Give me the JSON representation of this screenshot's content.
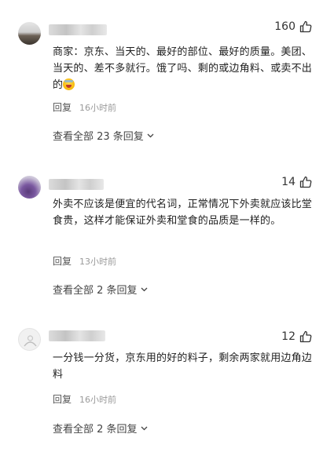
{
  "comments": [
    {
      "likes": "160",
      "text": "商家：京东、当天的、最好的部位、最好的质量。美团、当天的、差不多就行。饿了吗、剩的或边角料、或卖不出的",
      "reply_label": "回复",
      "time": "16小时前",
      "view_all": "查看全部 23 条回复"
    },
    {
      "likes": "14",
      "text": "外卖不应该是便宜的代名词，正常情况下外卖就应该比堂食贵，这样才能保证外卖和堂食的品质是一样的。",
      "reply_label": "回复",
      "time": "13小时前",
      "view_all": "查看全部 2 条回复"
    },
    {
      "likes": "12",
      "text": "一分钱一分货，京东用的好的料子，剩余两家就用边角边料",
      "reply_label": "回复",
      "time": "16小时前",
      "view_all": "查看全部 2 条回复"
    }
  ],
  "icons": {
    "like": "thumbs-up-icon",
    "expand": "chevron-down-icon",
    "emoji": "laughing-crying-emoji"
  }
}
